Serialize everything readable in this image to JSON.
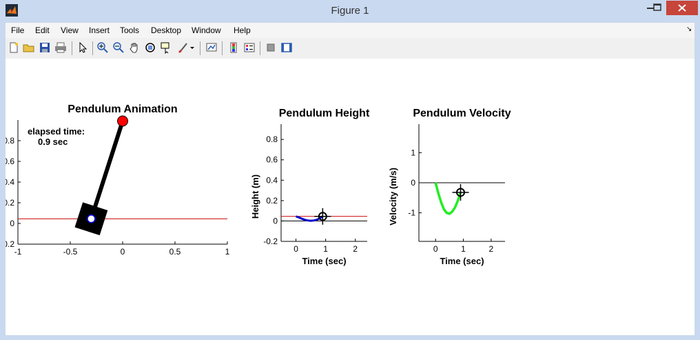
{
  "window": {
    "title": "Figure 1"
  },
  "menu": {
    "items": [
      "File",
      "Edit",
      "View",
      "Insert",
      "Tools",
      "Desktop",
      "Window",
      "Help"
    ],
    "corner_glyph": "↘"
  },
  "toolbar": {
    "buttons": [
      "new-figure-icon",
      "open-file-icon",
      "save-icon",
      "print-icon",
      "edit-plot-arrow-icon",
      "zoom-in-icon",
      "zoom-out-icon",
      "pan-hand-icon",
      "rotate-3d-icon",
      "data-cursor-icon",
      "brush-icon",
      "link-plot-icon",
      "colorbar-icon",
      "legend-icon",
      "hide-plot-tools-icon",
      "show-plot-tools-icon"
    ]
  },
  "chart_data": [
    {
      "type": "scatter",
      "title": "Pendulum Animation",
      "xlim": [
        -1,
        1
      ],
      "ylim": [
        -0.2,
        1
      ],
      "x_ticks": [
        "-1",
        "-0.5",
        "0",
        "0.5",
        "1"
      ],
      "y_ticks": [
        "-0.2",
        "0",
        "0.2",
        "0.4",
        "0.6",
        "0.8"
      ],
      "annotation_line1": "elapsed time:",
      "annotation_line2": "0.9 sec",
      "reference_line_y": 0.045,
      "pivot": [
        0,
        0.99
      ],
      "bob": [
        -0.3,
        0.045
      ],
      "colors": {
        "pivot": "#ff0000",
        "reference": "#cc0000",
        "rod": "#000000",
        "bob_center": "#0000ff"
      }
    },
    {
      "type": "line",
      "title": "Pendulum Height",
      "xlabel": "Time (sec)",
      "ylabel": "Height (m)",
      "xlim": [
        -0.5,
        2.4
      ],
      "ylim": [
        -0.2,
        0.95
      ],
      "x_ticks": [
        "0",
        "1",
        "2"
      ],
      "y_ticks": [
        "-0.2",
        "0",
        "0.2",
        "0.4",
        "0.6",
        "0.8"
      ],
      "reference_line_y": 0.045,
      "series": [
        {
          "x": [
            0,
            0.1,
            0.2,
            0.3,
            0.4,
            0.5,
            0.6,
            0.7,
            0.8,
            0.9
          ],
          "y": [
            0.045,
            0.035,
            0.022,
            0.012,
            0.005,
            0.002,
            0.005,
            0.012,
            0.025,
            0.045
          ],
          "color": "#0000cc"
        }
      ],
      "marker": [
        0.9,
        0.045
      ]
    },
    {
      "type": "line",
      "title": "Pendulum Velocity",
      "xlabel": "Time (sec)",
      "ylabel": "Velocity (m/s)",
      "xlim": [
        -0.6,
        2.5
      ],
      "ylim": [
        -1.95,
        1.95
      ],
      "x_ticks": [
        "0",
        "1",
        "2"
      ],
      "y_ticks": [
        "-1",
        "0",
        "1"
      ],
      "series": [
        {
          "x": [
            0,
            0.1,
            0.2,
            0.3,
            0.4,
            0.5,
            0.6,
            0.7,
            0.8,
            0.9
          ],
          "y": [
            0,
            -0.35,
            -0.65,
            -0.88,
            -1.0,
            -1.03,
            -0.96,
            -0.82,
            -0.6,
            -0.32
          ],
          "color": "#22ee22"
        }
      ],
      "marker": [
        0.9,
        -0.32
      ]
    }
  ]
}
